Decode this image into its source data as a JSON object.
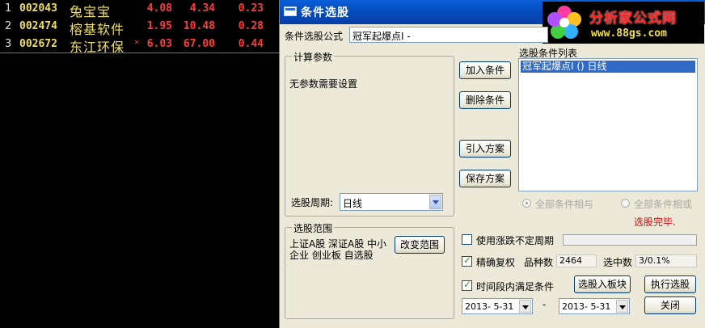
{
  "stocks": [
    {
      "index": "1",
      "code": "002043",
      "name": "兔宝宝",
      "mark": "",
      "price": "4.08",
      "value2": "4.34",
      "value3": "0.23"
    },
    {
      "index": "2",
      "code": "002474",
      "name": "榕基软件",
      "mark": "",
      "price": "1.95",
      "value2": "10.48",
      "value3": "0.28"
    },
    {
      "index": "3",
      "code": "002672",
      "name": "东江环保",
      "mark": "×",
      "price": "6.03",
      "value2": "67.00",
      "value3": "0.44"
    }
  ],
  "dialog": {
    "title": "条件选股",
    "logo": {
      "brand": "分析家公式网",
      "url": "www.88gs.com"
    },
    "formula_label": "条件选股公式",
    "formula_value": "冠军起爆点I -",
    "params_group": "计算参数",
    "params_text": "无参数需要设置",
    "period_label": "选股周期:",
    "period_value": "日线",
    "buttons": {
      "add": "加入条件",
      "delete": "删除条件",
      "import": "引入方案",
      "save": "保存方案",
      "change_range": "改变范围",
      "to_block": "选股入板块",
      "execute": "执行选股",
      "close": "关闭"
    },
    "conditions_label": "选股条件列表",
    "conditions": [
      "冠军起爆点I () 日线"
    ],
    "radio_and": "全部条件相与",
    "radio_or": "全部条件相或",
    "status": "选股完毕.",
    "range_group": "选股范围",
    "range_text": "上证A股 深证A股 中小企业 创业板 自选股",
    "use_uncertain_label": "使用涨跌不定周期",
    "precise_label": "精确复权",
    "count_label": "品种数",
    "count_value": "2464",
    "selected_label": "选中数",
    "selected_value": "3/0.1%",
    "period_satisfy_label": "时间段内满足条件",
    "date_from": "2013- 5-31",
    "date_sep": "-",
    "date_to": "2013- 5-31"
  },
  "colors": {
    "title_blue": "#0448b8",
    "stock_code": "#f0e060",
    "price_red": "#ff3c3c",
    "status_red": "#d01010"
  }
}
